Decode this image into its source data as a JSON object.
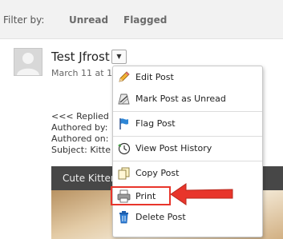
{
  "filter": {
    "label": "Filter by:",
    "unread": "Unread",
    "flagged": "Flagged"
  },
  "post": {
    "author": "Test Jfrost",
    "date": "March 11 at 1",
    "lines": [
      "<<< Replied",
      "Authored by:",
      "Authored on:",
      "Subject: Kitte"
    ],
    "attachment_title": "Cute Kitten"
  },
  "menu": {
    "items": [
      {
        "label": "Edit Post",
        "icon": "pencil-icon"
      },
      {
        "label": "Mark Post as Unread",
        "icon": "mark-unread-icon"
      },
      {
        "label": "Flag Post",
        "icon": "flag-icon"
      },
      {
        "label": "View Post History",
        "icon": "history-icon"
      },
      {
        "label": "Copy Post",
        "icon": "copy-icon"
      },
      {
        "label": "Print",
        "icon": "printer-icon"
      },
      {
        "label": "Delete Post",
        "icon": "trash-icon"
      }
    ]
  },
  "colors": {
    "highlight": "#e8352b"
  }
}
